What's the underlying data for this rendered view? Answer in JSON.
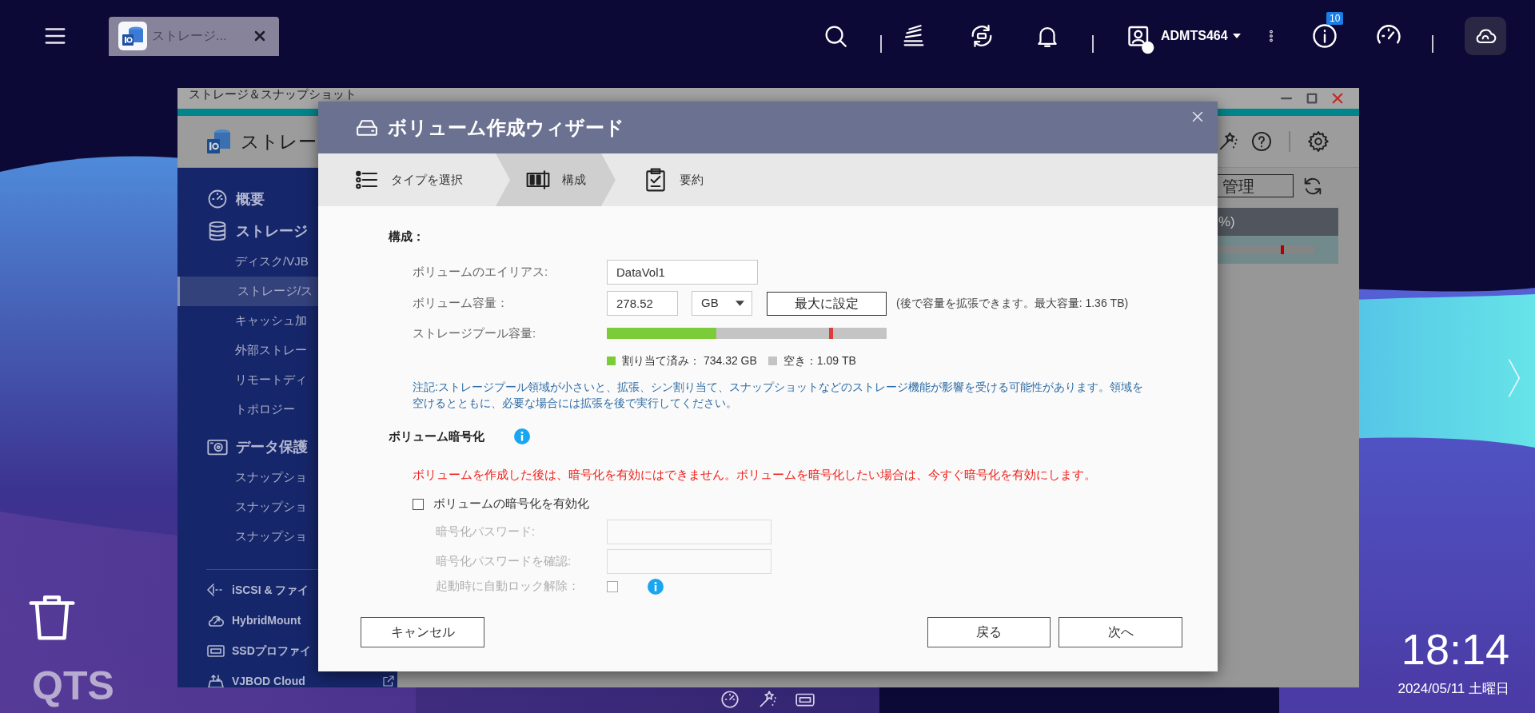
{
  "top_bar": {
    "task_tabs": [
      {
        "label": "ストレージ...",
        "selected": true
      }
    ],
    "user_name": "ADMTS464",
    "notification_badge": "10"
  },
  "app_window": {
    "title": "ストレージ＆スナップショット",
    "header_title": "ストレー",
    "sidebar": [
      {
        "label": "概要",
        "selected": false
      },
      {
        "label": "ストレージ",
        "selected": false,
        "children": [
          {
            "label": "ディスク/VJB",
            "selected": false
          },
          {
            "label": "ストレージ/ス",
            "selected": true
          },
          {
            "label": "キャッシュ加",
            "selected": false
          },
          {
            "label": "外部ストレー",
            "selected": false
          },
          {
            "label": "リモートディ",
            "selected": false
          },
          {
            "label": "トポロジー",
            "selected": false
          }
        ]
      },
      {
        "label": "データ保護",
        "selected": false,
        "children": [
          {
            "label": "スナップショ",
            "selected": false
          },
          {
            "label": "スナップショ",
            "selected": false
          },
          {
            "label": "スナップショ",
            "selected": false
          }
        ]
      }
    ],
    "sidebar_bottom": [
      {
        "label": "iSCSI & ファイ"
      },
      {
        "label": "HybridMount"
      },
      {
        "label": "SSDプロファイ"
      },
      {
        "label": "VJBOD Cloud",
        "external": true
      }
    ],
    "manage_button": "管理",
    "table_header": "%)"
  },
  "dialog": {
    "title": "ボリューム作成ウィザード",
    "steps": [
      {
        "label": "タイプを選択",
        "selected": false
      },
      {
        "label": "構成",
        "selected": true
      },
      {
        "label": "要約",
        "selected": false
      }
    ],
    "config": {
      "heading": "構成：",
      "alias": {
        "label": "ボリュームのエイリアス:",
        "value": "DataVol1"
      },
      "capacity": {
        "label": "ボリューム容量：",
        "value": "278.52",
        "unit": "GB",
        "max_button": "最大に設定",
        "hint": "(後で容量を拡張できます。最大容量: 1.36 TB)"
      },
      "pool": {
        "label": "ストレージプール容量:",
        "allocated": {
          "level": 0.39,
          "legend": "割り当て済み： 734.32 GB"
        },
        "free": {
          "legend": "空き：1.09 TB"
        },
        "new_volume": {
          "level": 0.8
        }
      },
      "note": "注記:ストレージプール領域が小さいと、拡張、シン割り当て、スナップショットなどのストレージ機能が影響を受ける可能性があります。領域を空けるとともに、必要な場合には拡張を後で実行してください。"
    },
    "encryption": {
      "heading": "ボリューム暗号化",
      "warning": "ボリュームを作成した後は、暗号化を有効にはできません。ボリュームを暗号化したい場合は、今すぐ暗号化を有効にします。",
      "enable": {
        "label": "ボリュームの暗号化を有効化",
        "checked": false
      },
      "fields": [
        {
          "label": "暗号化パスワード:",
          "disabled": true
        },
        {
          "label": "暗号化パスワードを確認:",
          "disabled": true
        }
      ],
      "auto_unlock": {
        "label": "起動時に自動ロック解除：",
        "checked": false,
        "disabled": true
      }
    },
    "buttons": {
      "cancel": "キャンセル",
      "back": "戻る",
      "next": "次へ"
    }
  },
  "desktop": {
    "brand": "QTS",
    "time": "18:14",
    "date": "2024/05/11 土曜日"
  }
}
